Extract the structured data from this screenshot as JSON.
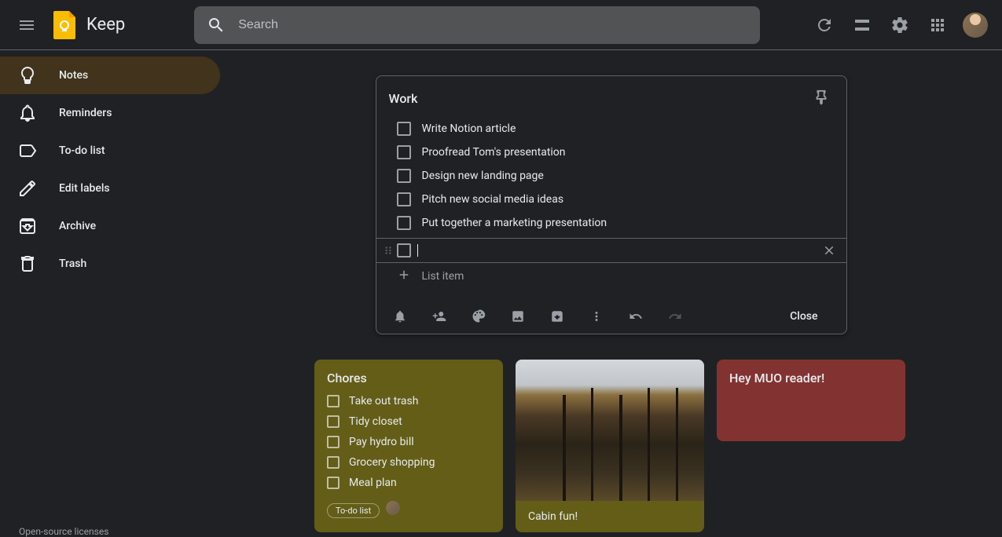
{
  "app": {
    "title": "Keep"
  },
  "search": {
    "placeholder": "Search"
  },
  "sidebar": {
    "items": [
      {
        "label": "Notes"
      },
      {
        "label": "Reminders"
      },
      {
        "label": "To-do list"
      },
      {
        "label": "Edit labels"
      },
      {
        "label": "Archive"
      },
      {
        "label": "Trash"
      }
    ],
    "footer": "Open-source licenses"
  },
  "editor": {
    "title": "Work",
    "items": [
      "Write Notion article",
      "Proofread Tom's presentation",
      "Design new landing page",
      "Pitch new social media ideas",
      "Put together a marketing presentation"
    ],
    "addItemLabel": "List item",
    "closeLabel": "Close"
  },
  "notes": {
    "chores": {
      "title": "Chores",
      "items": [
        "Take out trash",
        "Tidy closet",
        "Pay hydro bill",
        "Grocery shopping",
        "Meal plan"
      ],
      "chip": "To-do list"
    },
    "cabin": {
      "caption": "Cabin fun!"
    },
    "muo": {
      "title": "Hey MUO reader!"
    }
  }
}
